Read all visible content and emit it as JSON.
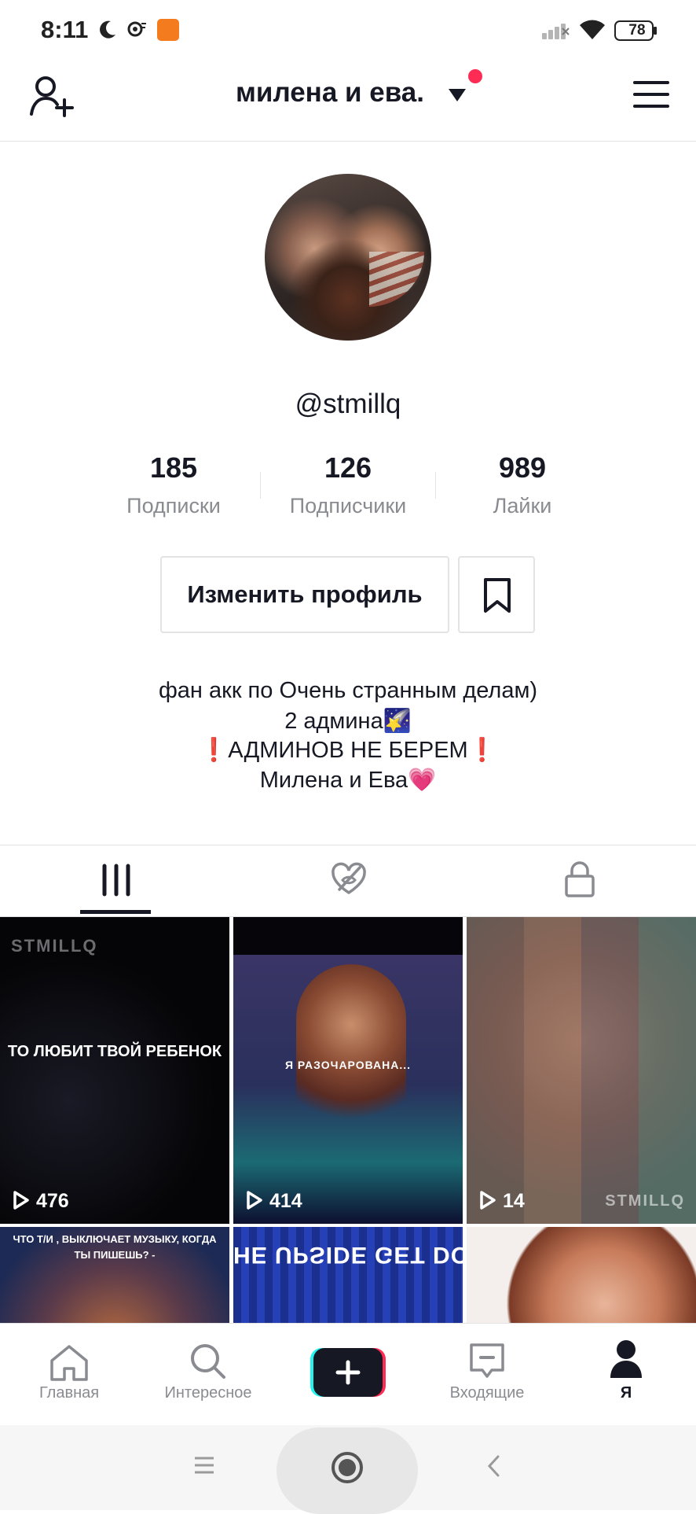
{
  "status_bar": {
    "time": "8:11",
    "battery": "78"
  },
  "header": {
    "account_name": "милена и ева."
  },
  "profile": {
    "handle": "@stmillq",
    "stats": [
      {
        "value": "185",
        "label": "Подписки"
      },
      {
        "value": "126",
        "label": "Подписчики"
      },
      {
        "value": "989",
        "label": "Лайки"
      }
    ],
    "edit_button": "Изменить профиль",
    "bio": [
      "фан акк по Очень странным делам)",
      "2 админа🌠",
      "❗АДМИНОВ НЕ БЕРЕМ❗",
      "Милена и Ева💗"
    ]
  },
  "tabs": [
    {
      "name": "videos",
      "icon": "grid-icon",
      "active": true
    },
    {
      "name": "liked",
      "icon": "hidden-heart-icon",
      "active": false
    },
    {
      "name": "private",
      "icon": "lock-icon",
      "active": false
    }
  ],
  "videos": [
    {
      "views": "476",
      "overlay_text": "ТО ЛЮБИТ ТВОЙ РЕБЕНОК",
      "watermark": "STMILLQ"
    },
    {
      "views": "414",
      "overlay_text": "Я РАЗОЧАРОВАНА..."
    },
    {
      "views": "14",
      "watermark": "STMILLQ"
    },
    {
      "overlay_text": "ЧТО Т/И , ВЫКЛЮЧАЕТ МУЗЫКУ, КОГДА ТЫ ПИШЕШЬ? -"
    },
    {
      "overlay_text": "HE UPSIDE GET DO"
    },
    {}
  ],
  "bottom_nav": [
    {
      "label": "Главная",
      "icon": "home-icon"
    },
    {
      "label": "Интересное",
      "icon": "search-icon"
    },
    {
      "label": "",
      "icon": "plus-icon"
    },
    {
      "label": "Входящие",
      "icon": "inbox-icon"
    },
    {
      "label": "Я",
      "icon": "profile-icon",
      "active": true
    }
  ],
  "colors": {
    "accent": "#fe2c55",
    "text": "#161823",
    "muted": "#8a8b91",
    "border": "#e3e3e4"
  }
}
